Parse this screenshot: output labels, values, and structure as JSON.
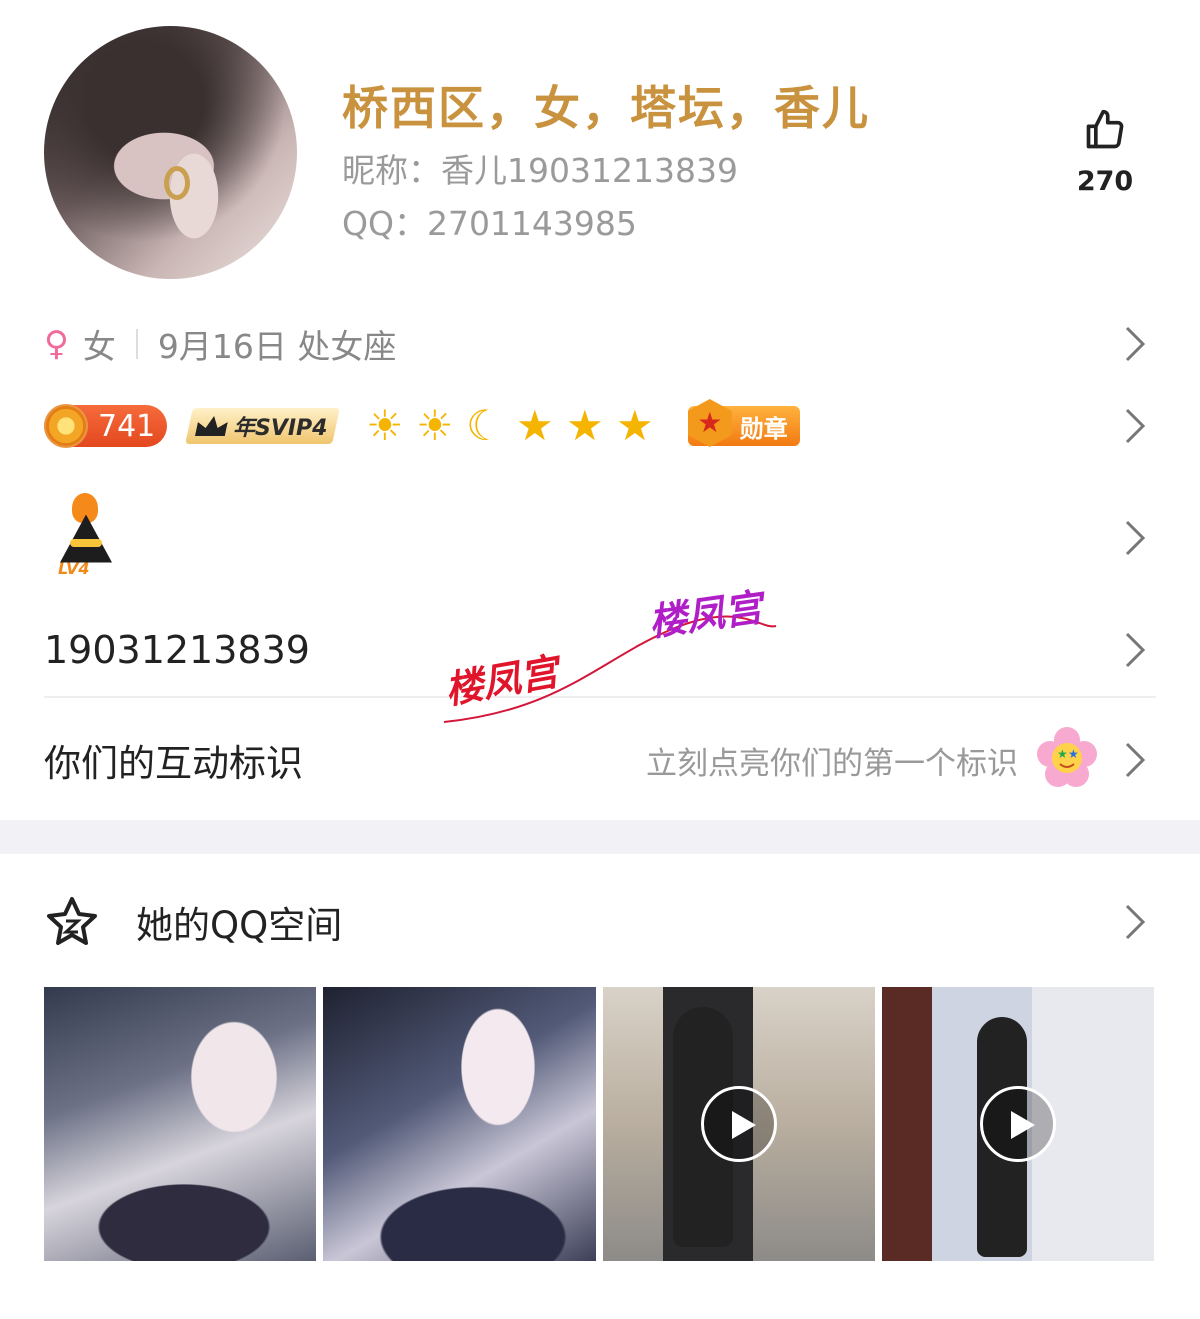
{
  "header": {
    "title": "桥西区，女，塔坛，香儿",
    "nickname": "昵称：香儿19031213839",
    "qq": "QQ：2701143985",
    "likes": "270"
  },
  "info": {
    "gender_symbol": "♀",
    "gender": "女",
    "birthday": "9月16日 处女座"
  },
  "badges": {
    "coin_value": "741",
    "svip_label": "年SVIP4",
    "level_icons": [
      "sun",
      "sun",
      "moon",
      "star",
      "star",
      "star"
    ],
    "medal_label": "勋章"
  },
  "lv_badge": "LV4",
  "phone": "19031213839",
  "interaction": {
    "label": "你们的互动标识",
    "hint": "立刻点亮你们的第一个标识"
  },
  "qzone": {
    "label": "她的QQ空间"
  },
  "watermark": [
    "楼凤宫",
    "楼凤宫"
  ],
  "colors": {
    "title": "#c9923e",
    "secondary_text": "#9a9a9a",
    "female": "#f06b9b"
  }
}
